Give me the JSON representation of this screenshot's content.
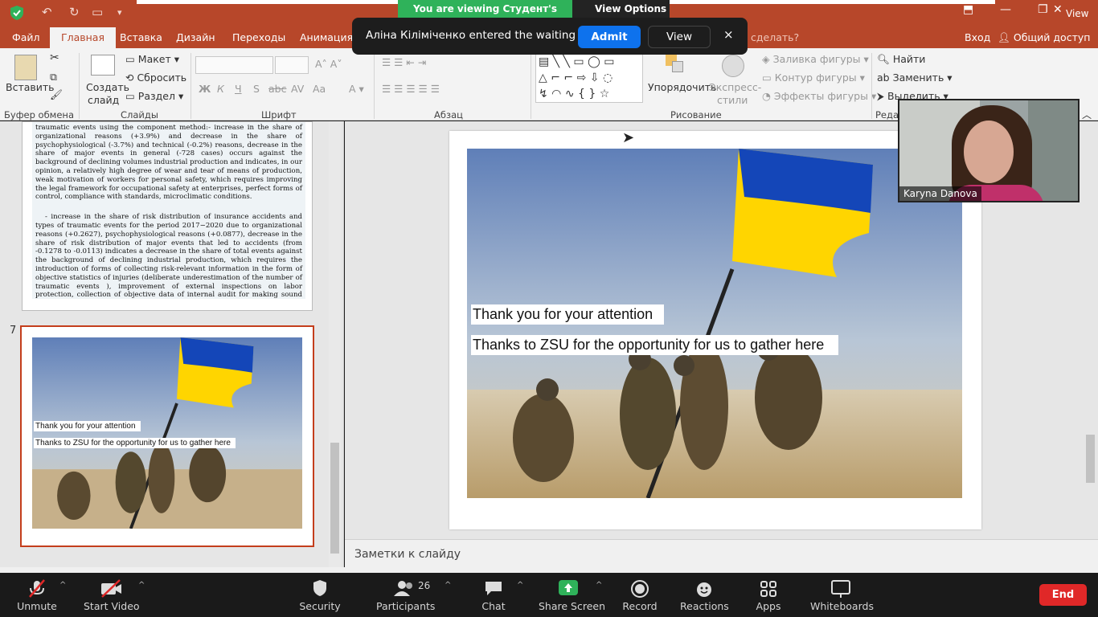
{
  "zoom": {
    "viewing_banner": "You are viewing Студент's screen",
    "view_options": "View Options",
    "view_corner": "View",
    "notification": {
      "message": "Аліна Кіліміченко entered the waiting room",
      "admit": "Admit",
      "view": "View",
      "close": "×"
    },
    "video": {
      "name": "Karyna Danova"
    },
    "toolbar": {
      "unmute": "Unmute",
      "start_video": "Start Video",
      "security": "Security",
      "participants": "Participants",
      "participants_count": "26",
      "chat": "Chat",
      "share_screen": "Share Screen",
      "record": "Record",
      "reactions": "Reactions",
      "apps": "Apps",
      "whiteboards": "Whiteboards",
      "end": "End"
    },
    "colors": {
      "share_green": "#2fb25a",
      "admit_blue": "#0e72ed",
      "end_red": "#e02828"
    }
  },
  "ppt": {
    "tabs": [
      "Файл",
      "Главная",
      "Вставка",
      "Дизайн",
      "Переходы",
      "Анимация"
    ],
    "tell_me": "сделать?",
    "sign_in": "Вход",
    "share": "Общий доступ",
    "ribbon": {
      "clipboard": {
        "paste": "Вставить",
        "label": "Буфер обмена"
      },
      "slides": {
        "new": "Создать",
        "new2": "слайд",
        "layout": "Макет",
        "reset": "Сбросить",
        "section": "Раздел",
        "label": "Слайды"
      },
      "font": {
        "label": "Шрифт"
      },
      "paragraph": {
        "label": "Абзац"
      },
      "drawing": {
        "arrange": "Упорядочить",
        "styles": "Экспресс-",
        "styles2": "стили",
        "fill": "Заливка фигуры",
        "outline": "Контур фигуры",
        "effects": "Эффекты фигуры",
        "label": "Рисование"
      },
      "editing": {
        "find": "Найти",
        "replace": "Заменить",
        "select": "Выделить",
        "label": "Редак"
      }
    },
    "thumb6_text1": "traumatic events using the component method:- increase in the share of organizational reasons (+3.9%) and decrease in the share of psychophysiological (-3.7%) and technical (-0.2%) reasons, decrease in the share of major events in general (-728 cases) occurs against the background of declining volumes industrial production and indicates, in our opinion, a relatively high degree of wear and tear of means of production, weak motivation of workers for personal safety, which requires improving the legal framework for occupational safety at enterprises, perfect forms of control, compliance with standards, microclimatic conditions.",
    "thumb6_text2": "- increase in the share of risk distribution of insurance accidents and types of traumatic events for the period 2017−2020 due to organizational reasons (+0.2627), psychophysiological reasons (+0.0877), decrease in the share of risk distribution of major events that led to accidents (from -0.1278 to -0.0113) indicates a decrease in the share of total events against the background of declining industrial production, which requires the introduction of forms of collecting risk-relevant information in the form of objective statistics of injuries (deliberate underestimation of the number of traumatic events ), improvement of external inspections on labor protection, collection of objective data of internal audit for making sound management decisions to reduce the level of industrial risks.",
    "slide_number": "7",
    "slide": {
      "line1": "Thank you for your attention",
      "line2": "Thanks to ZSU for the opportunity for us to gather here"
    },
    "notes_placeholder": "Заметки к слайду"
  }
}
